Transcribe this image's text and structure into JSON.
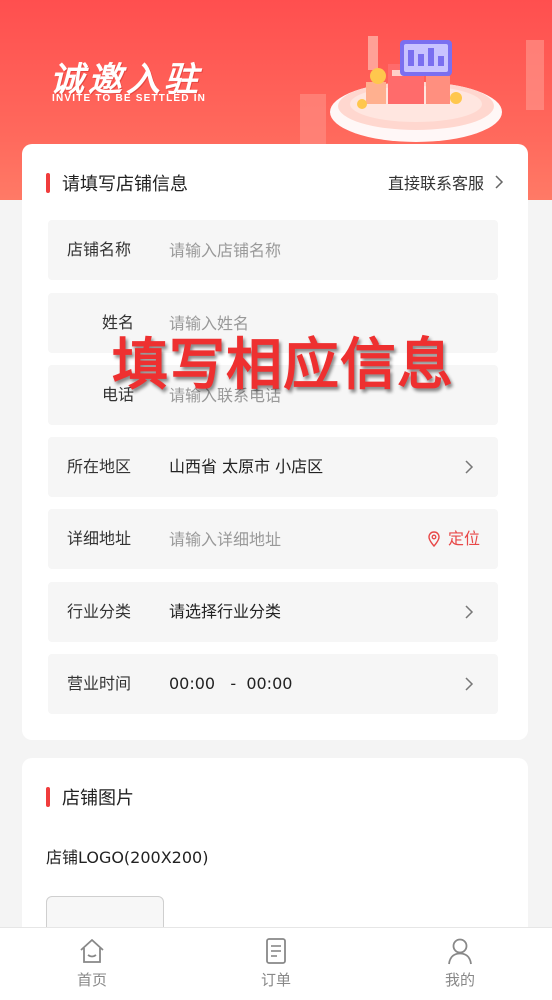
{
  "banner": {
    "title": "诚邀入驻",
    "subtitle": "INVITE TO BE SETTLED IN"
  },
  "shop_info": {
    "title": "请填写店铺信息",
    "service_link": "直接联系客服",
    "fields": {
      "shop_name": {
        "label": "店铺名称",
        "placeholder": "请输入店铺名称"
      },
      "name": {
        "label": "姓名",
        "placeholder": "请输入姓名"
      },
      "phone": {
        "label": "电话",
        "placeholder": "请输入联系电话"
      },
      "region": {
        "label": "所在地区",
        "value": "山西省 太原市 小店区"
      },
      "address": {
        "label": "详细地址",
        "placeholder": "请输入详细地址",
        "locate_label": "定位"
      },
      "category": {
        "label": "行业分类",
        "value": "请选择行业分类"
      },
      "hours": {
        "label": "营业时间",
        "value": "00:00   -  00:00"
      }
    }
  },
  "overlay_text": "填写相应信息",
  "shop_images": {
    "title": "店铺图片",
    "logo_label": "店铺LOGO(200X200)"
  },
  "tabbar": {
    "items": [
      {
        "label": "首页",
        "icon": "home-icon"
      },
      {
        "label": "订单",
        "icon": "order-icon"
      },
      {
        "label": "我的",
        "icon": "user-icon"
      }
    ]
  },
  "colors": {
    "brand_red": "#ff4f4f",
    "accent": "#f03c3c",
    "locate": "#e84848"
  }
}
